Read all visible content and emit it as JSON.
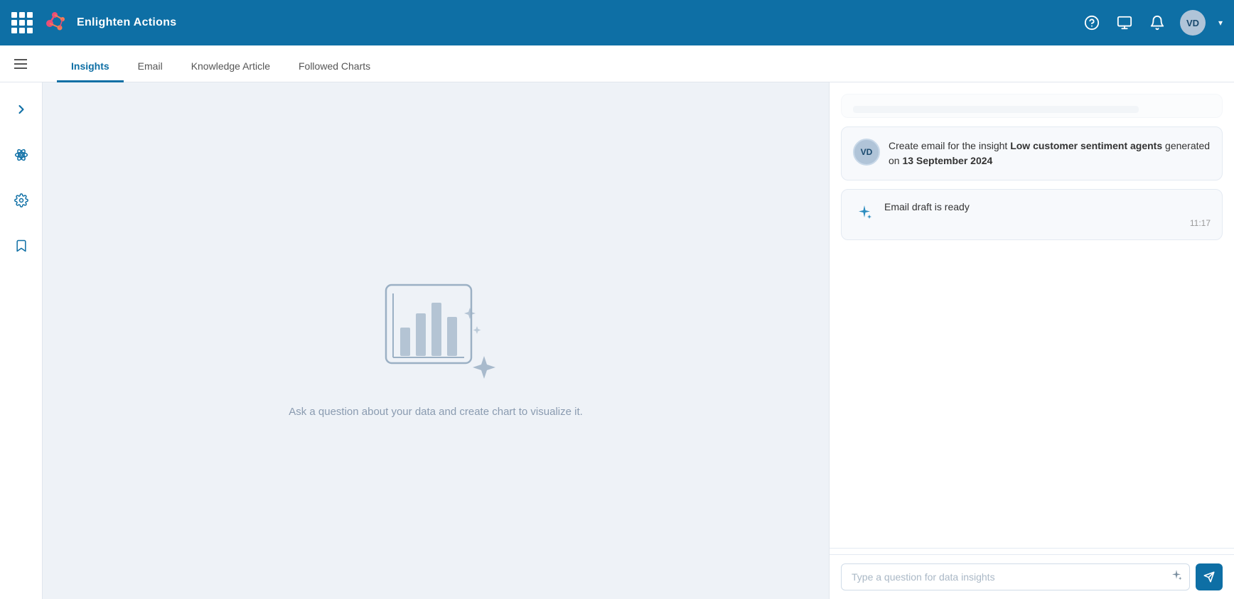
{
  "topnav": {
    "app_title": "Enlighten Actions",
    "logo_initials": "VD",
    "help_icon": "help-icon",
    "monitor_icon": "monitor-icon",
    "bell_icon": "bell-icon"
  },
  "tabs": {
    "items": [
      {
        "id": "insights",
        "label": "Insights",
        "active": true
      },
      {
        "id": "email",
        "label": "Email",
        "active": false
      },
      {
        "id": "knowledge-article",
        "label": "Knowledge Article",
        "active": false
      },
      {
        "id": "followed-charts",
        "label": "Followed Charts",
        "active": false
      }
    ]
  },
  "sidebar": {
    "items": [
      {
        "id": "expand",
        "icon": "chevron-right-icon"
      },
      {
        "id": "atom",
        "icon": "atom-icon"
      },
      {
        "id": "settings",
        "icon": "gear-icon"
      },
      {
        "id": "bookmark",
        "icon": "bookmark-icon"
      }
    ]
  },
  "chart_placeholder": {
    "text": "Ask a question about your data and create chart to visualize it."
  },
  "chat": {
    "messages": [
      {
        "type": "user",
        "avatar": "VD",
        "text_parts": [
          {
            "text": "Create email for the insight ",
            "bold": false
          },
          {
            "text": "Low customer sentiment agents",
            "bold": true
          },
          {
            "text": " generated on ",
            "bold": false
          },
          {
            "text": "13 September 2024",
            "bold": true
          }
        ]
      },
      {
        "type": "ai",
        "text": "Email draft is ready",
        "timestamp": "11:17"
      }
    ],
    "input_placeholder": "Type a question for data insights"
  }
}
